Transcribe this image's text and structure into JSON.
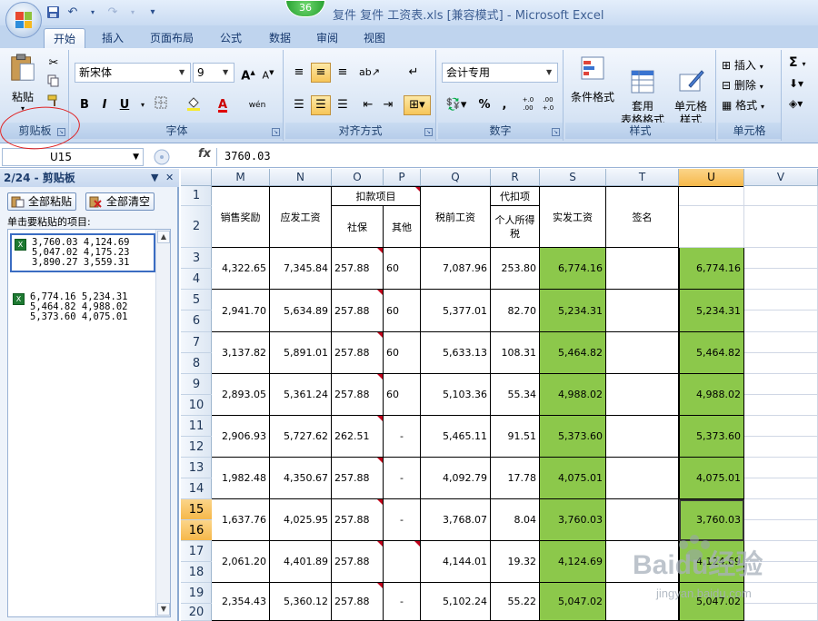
{
  "app": {
    "title": "复件 复件 工资表.xls  [兼容模式] - Microsoft Excel",
    "badge": "36"
  },
  "tabs": [
    {
      "label": "开始",
      "active": true
    },
    {
      "label": "插入"
    },
    {
      "label": "页面布局"
    },
    {
      "label": "公式"
    },
    {
      "label": "数据"
    },
    {
      "label": "审阅"
    },
    {
      "label": "视图"
    }
  ],
  "ribbon": {
    "clipboard": {
      "label": "剪贴板",
      "paste": "粘贴"
    },
    "font": {
      "label": "字体",
      "name": "新宋体",
      "size": "9",
      "bold": "B",
      "italic": "I",
      "underline": "U",
      "grow": "A",
      "shrink": "A",
      "color_char": "A"
    },
    "align": {
      "label": "对齐方式"
    },
    "number": {
      "label": "数字",
      "format": "会计专用",
      "percent": "%",
      "comma": ",",
      "inc_dec": "+.0 .00",
      "dec_dec": ".00 +.0"
    },
    "styles": {
      "label": "样式",
      "cond": "条件格式",
      "table": "套用\n表格格式",
      "cell": "单元格\n样式"
    },
    "cells": {
      "label": "单元格",
      "insert": "插入",
      "delete": "删除",
      "format": "格式"
    },
    "editing": {
      "sigma": "Σ"
    }
  },
  "formula_bar": {
    "name_box": "U15",
    "fx": "fx",
    "value": "3760.03"
  },
  "clipboard_pane": {
    "title": "2/24 - 剪贴板",
    "paste_all": "全部粘贴",
    "clear_all": "全部清空",
    "hint": "单击要粘贴的项目:",
    "items": [
      {
        "lines": [
          "3,760.03 4,124.69",
          "5,047.02 4,175.23",
          "3,890.27 3,559.31"
        ],
        "selected": true
      },
      {
        "lines": [
          "6,774.16 5,234.31",
          "5,464.82 4,988.02",
          "5,373.60 4,075.01"
        ],
        "selected": false
      }
    ]
  },
  "sheet": {
    "columns": [
      "M",
      "N",
      "O",
      "P",
      "Q",
      "R",
      "S",
      "T",
      "U",
      "V"
    ],
    "selected_column": "U",
    "row_numbers": [
      "1",
      "2",
      "3",
      "4",
      "5",
      "6",
      "7",
      "8",
      "9",
      "10",
      "11",
      "12",
      "13",
      "14",
      "15",
      "16",
      "17",
      "18",
      "19",
      "20"
    ],
    "selected_rows": [
      "15",
      "16"
    ],
    "headers": {
      "M": "销售奖励",
      "N": "应发工资",
      "deduct_group": "扣款项目",
      "O": "社保",
      "P": "其他",
      "Q": "税前工资",
      "R_group": "代扣项",
      "R": "个人所得税",
      "S": "实发工资",
      "T": "签名"
    },
    "rows": [
      {
        "M": "4,322.65",
        "N": "7,345.84",
        "O": "257.88",
        "P": "60",
        "Q": "7,087.96",
        "R": "253.80",
        "S": "6,774.16",
        "U": "6,774.16"
      },
      {
        "M": "2,941.70",
        "N": "5,634.89",
        "O": "257.88",
        "P": "60",
        "Q": "5,377.01",
        "R": "82.70",
        "S": "5,234.31",
        "U": "5,234.31"
      },
      {
        "M": "3,137.82",
        "N": "5,891.01",
        "O": "257.88",
        "P": "60",
        "Q": "5,633.13",
        "R": "108.31",
        "S": "5,464.82",
        "U": "5,464.82"
      },
      {
        "M": "2,893.05",
        "N": "5,361.24",
        "O": "257.88",
        "P": "60",
        "Q": "5,103.36",
        "R": "55.34",
        "S": "4,988.02",
        "U": "4,988.02"
      },
      {
        "M": "2,906.93",
        "N": "5,727.62",
        "O": "262.51",
        "P": "-",
        "Q": "5,465.11",
        "R": "91.51",
        "S": "5,373.60",
        "U": "5,373.60"
      },
      {
        "M": "1,982.48",
        "N": "4,350.67",
        "O": "257.88",
        "P": "-",
        "Q": "4,092.79",
        "R": "17.78",
        "S": "4,075.01",
        "U": "4,075.01"
      },
      {
        "M": "1,637.76",
        "N": "4,025.95",
        "O": "257.88",
        "P": "-",
        "Q": "3,768.07",
        "R": "8.04",
        "S": "3,760.03",
        "U": "3,760.03"
      },
      {
        "M": "2,061.20",
        "N": "4,401.89",
        "O": "257.88",
        "P": "",
        "Q": "4,144.01",
        "R": "19.32",
        "S": "4,124.69",
        "U": "4,124.69"
      },
      {
        "M": "2,354.43",
        "N": "5,360.12",
        "O": "257.88",
        "P": "-",
        "Q": "5,102.24",
        "R": "55.22",
        "S": "5,047.02",
        "U": "5,047.02"
      }
    ]
  },
  "watermark": {
    "brand": "Baidu经验",
    "url": "jingyan.baidu.com"
  },
  "colors": {
    "green_fill": "#8cc84b",
    "accent": "#2a4f8e"
  }
}
